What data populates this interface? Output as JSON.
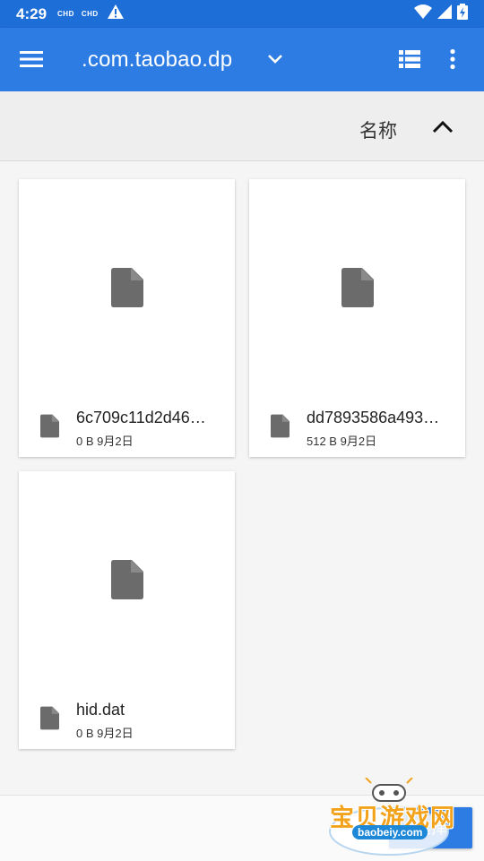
{
  "status_bar": {
    "time": "4:29",
    "carrier1": "CHD",
    "carrier2": "CHD"
  },
  "app_bar": {
    "title": ".com.taobao.dp",
    "menu_icon": "hamburger-menu-icon",
    "dropdown_icon": "chevron-down-icon",
    "view_icon": "list-view-icon",
    "more_icon": "more-vert-icon"
  },
  "sort": {
    "label": "名称",
    "direction_icon": "chevron-up-icon"
  },
  "files": [
    {
      "name": "6c709c11d2d46…",
      "size": "0 B",
      "date": "9月2日"
    },
    {
      "name": "dd7893586a493…",
      "size": "512 B",
      "date": "9月2日"
    },
    {
      "name": "hid.dat",
      "size": "0 B",
      "date": "9月2日"
    }
  ],
  "bottom": {
    "select_label": "选择"
  },
  "watermark": {
    "text": "宝贝游戏网",
    "url": "baobeiy.com"
  },
  "colors": {
    "status_bar": "#1e6ed8",
    "app_bar": "#2d7ce4",
    "file_icon": "#6b6b6b",
    "watermark": "#f3a31b"
  }
}
